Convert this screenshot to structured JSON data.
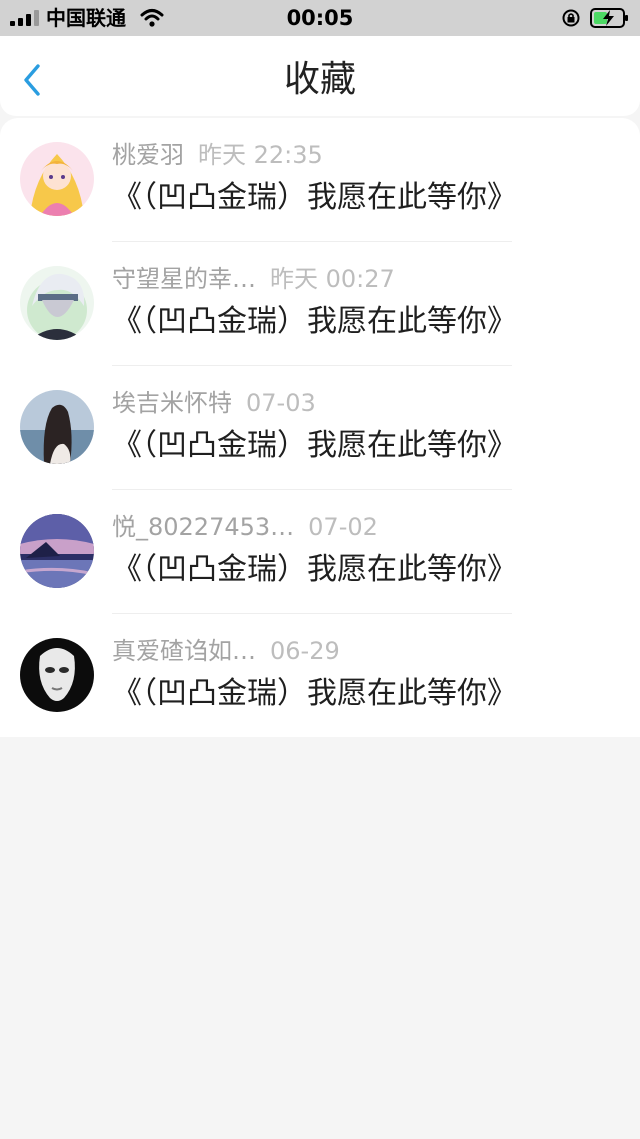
{
  "status_bar": {
    "carrier": "中国联通",
    "time": "00:05"
  },
  "header": {
    "title": "收藏"
  },
  "items": [
    {
      "user": "桃爱羽",
      "time": "昨天 22:35",
      "title": "《（凹凸金瑞）我愿在此等你》"
    },
    {
      "user": "守望星的幸…",
      "time": "昨天 00:27",
      "title": "《（凹凸金瑞）我愿在此等你》"
    },
    {
      "user": "埃吉米怀特",
      "time": "07-03",
      "title": "《（凹凸金瑞）我愿在此等你》"
    },
    {
      "user": "悦_80227453…",
      "time": "07-02",
      "title": "《（凹凸金瑞）我愿在此等你》"
    },
    {
      "user": "真爱碴诌如…",
      "time": "06-29",
      "title": "《（凹凸金瑞）我愿在此等你》"
    }
  ]
}
